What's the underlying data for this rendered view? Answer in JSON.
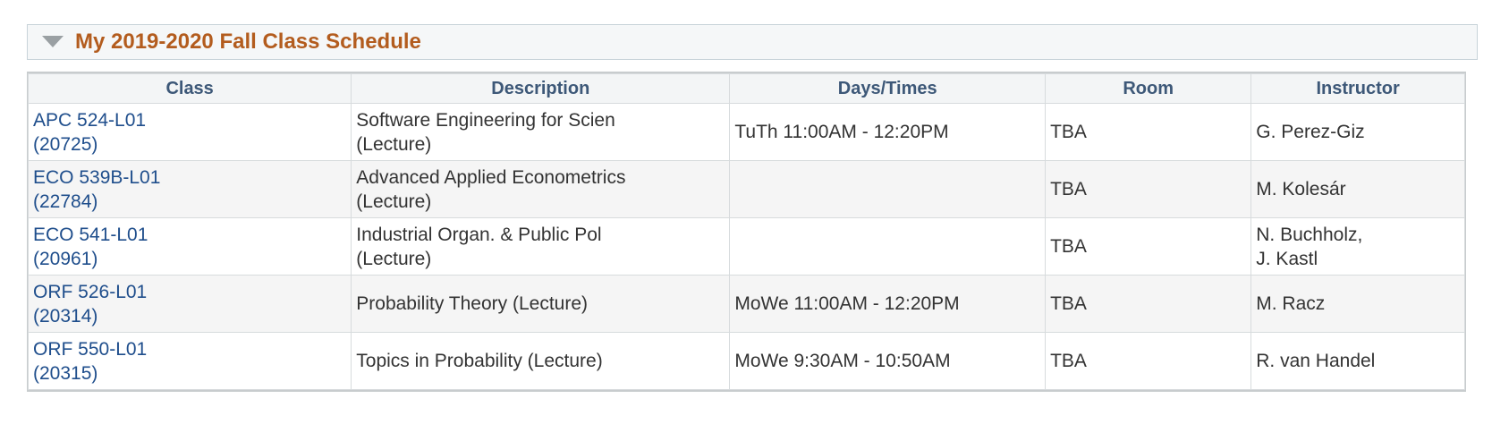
{
  "panel": {
    "title": "My 2019-2020 Fall Class Schedule",
    "toggle_icon": "triangle-down-icon"
  },
  "table": {
    "headers": [
      "Class",
      "Description",
      "Days/Times",
      "Room",
      "Instructor"
    ],
    "rows": [
      {
        "class_code": "APC 524-L01",
        "class_number": "(20725)",
        "description_line1": "Software Engineering for Scien",
        "description_line2": "(Lecture)",
        "days_times": "TuTh 11:00AM - 12:20PM",
        "room": "TBA",
        "instructor_line1": "G. Perez-Giz",
        "instructor_line2": ""
      },
      {
        "class_code": "ECO 539B-L01",
        "class_number": "(22784)",
        "description_line1": "Advanced Applied Econometrics",
        "description_line2": "(Lecture)",
        "days_times": "",
        "room": "TBA",
        "instructor_line1": "M. Kolesár",
        "instructor_line2": ""
      },
      {
        "class_code": "ECO 541-L01",
        "class_number": "(20961)",
        "description_line1": "Industrial Organ. & Public Pol",
        "description_line2": "(Lecture)",
        "days_times": "",
        "room": "TBA",
        "instructor_line1": "N. Buchholz,",
        "instructor_line2": "J. Kastl"
      },
      {
        "class_code": "ORF 526-L01",
        "class_number": "(20314)",
        "description_line1": "Probability Theory (Lecture)",
        "description_line2": "",
        "days_times": "MoWe 11:00AM - 12:20PM",
        "room": "TBA",
        "instructor_line1": "M. Racz",
        "instructor_line2": ""
      },
      {
        "class_code": "ORF 550-L01",
        "class_number": "(20315)",
        "description_line1": "Topics in Probability (Lecture)",
        "description_line2": "",
        "days_times": "MoWe 9:30AM - 10:50AM",
        "room": "TBA",
        "instructor_line1": "R. van Handel",
        "instructor_line2": ""
      }
    ]
  },
  "colors": {
    "title": "#b35c1e",
    "link": "#1f4e8c",
    "header_text": "#3d5878",
    "text": "#333333"
  }
}
